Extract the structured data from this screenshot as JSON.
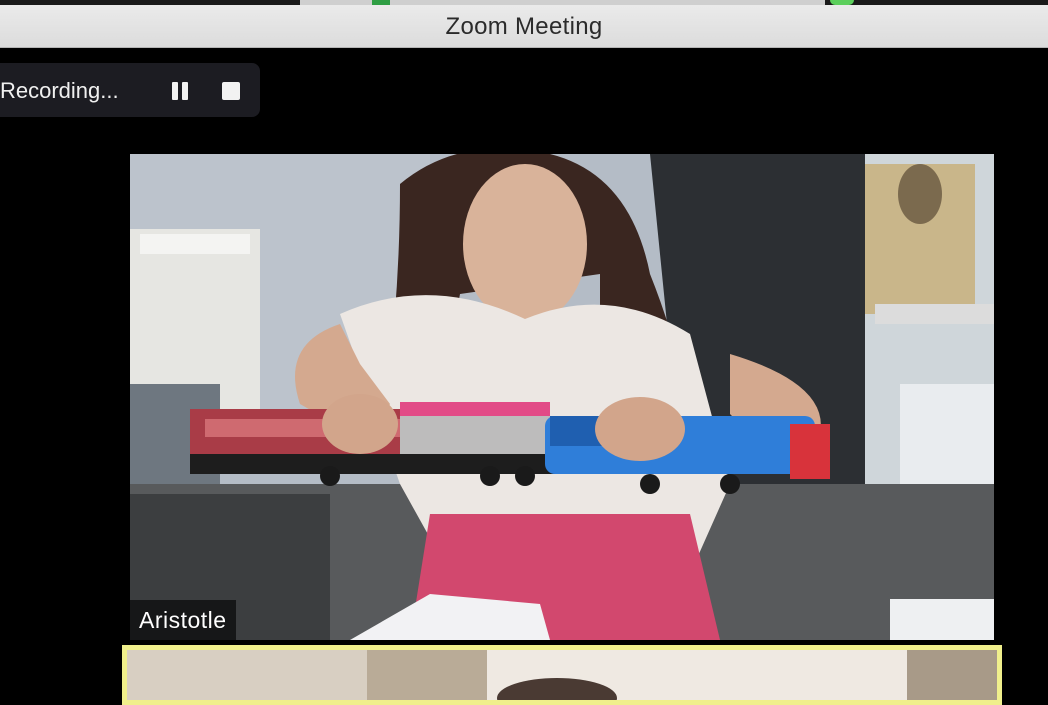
{
  "window": {
    "title": "Zoom Meeting"
  },
  "recording": {
    "label": "Recording...",
    "pause_icon": "pause-icon",
    "stop_icon": "stop-icon"
  },
  "participants": [
    {
      "name": "Aristotle",
      "active": false
    },
    {
      "name": "",
      "active": true
    }
  ],
  "colors": {
    "titlebar": "#e4e4e4",
    "recording_bg": "#1c1c22",
    "active_speaker_border": "#f0ef8c",
    "background": "#000000"
  }
}
